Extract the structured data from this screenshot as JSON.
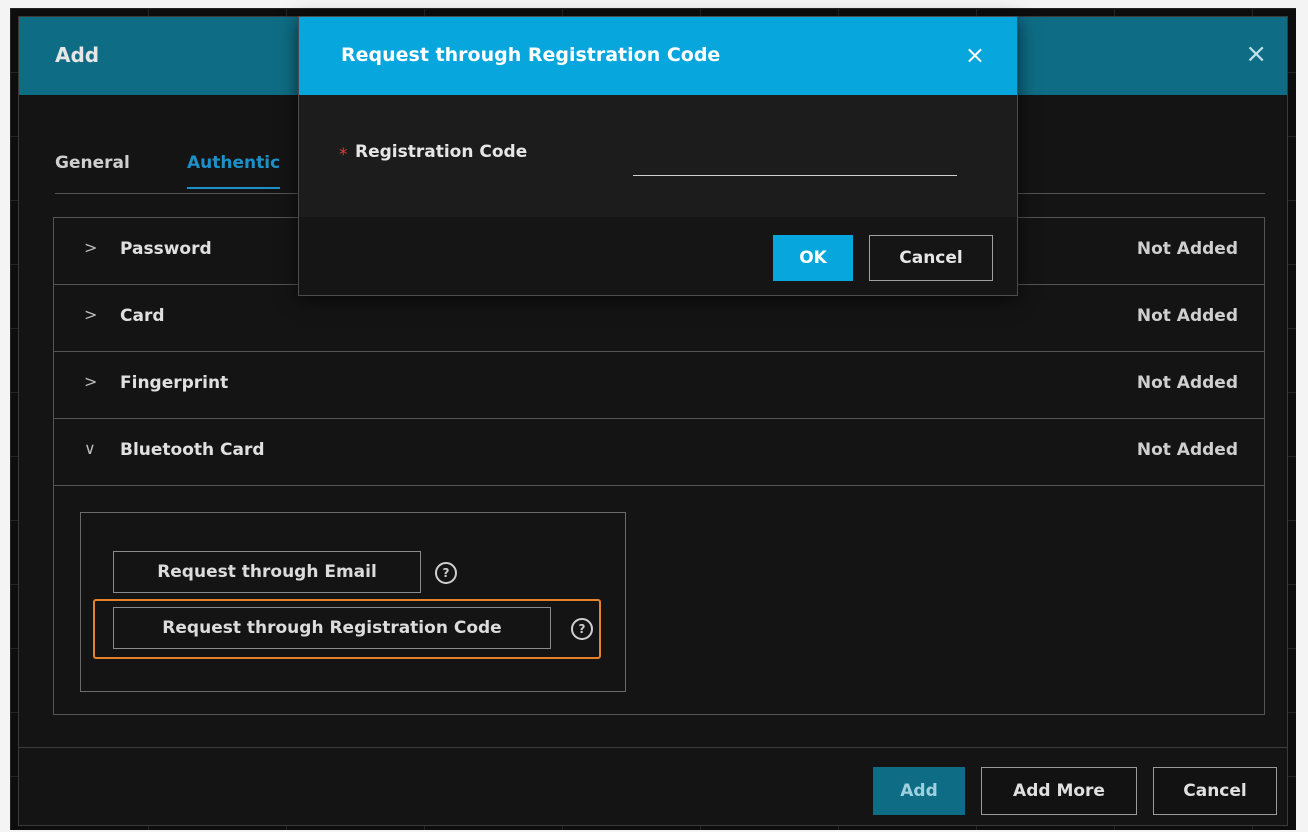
{
  "main_dialog": {
    "title": "Add",
    "close_icon": "×",
    "tabs": [
      {
        "label": "General"
      },
      {
        "label": "Authentic"
      }
    ],
    "sections": [
      {
        "label": "Password",
        "status": "Not Added",
        "chevron": ">"
      },
      {
        "label": "Card",
        "status": "Not Added",
        "chevron": ">"
      },
      {
        "label": "Fingerprint",
        "status": "Not Added",
        "chevron": ">"
      },
      {
        "label": "Bluetooth Card",
        "status": "Not Added",
        "chevron": "∨"
      }
    ],
    "bluetooth_panel": {
      "email_button": "Request through Email",
      "reg_button": "Request through Registration Code",
      "help_icon": "?"
    },
    "footer": {
      "add": "Add",
      "add_more": "Add More",
      "cancel": "Cancel"
    }
  },
  "reg_dialog": {
    "title": "Request through Registration Code",
    "close_icon": "×",
    "required_marker": "*",
    "field_label": "Registration Code",
    "field_value": "",
    "ok": "OK",
    "cancel": "Cancel"
  },
  "colors": {
    "main_header": "#0e6d84",
    "dialog_header": "#07a6dd",
    "highlight": "#e8822a",
    "active_tab": "#1e90c8"
  }
}
